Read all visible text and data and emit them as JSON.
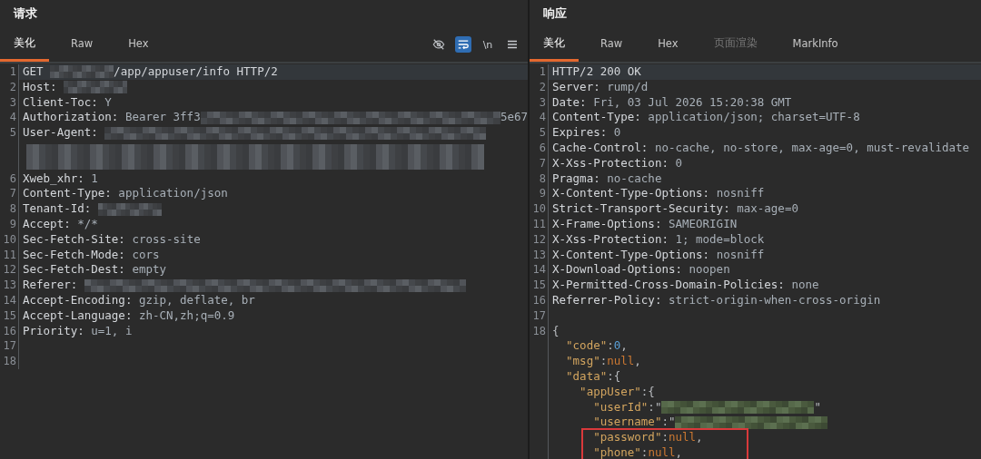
{
  "request": {
    "title": "请求",
    "tabs": [
      {
        "label": "美化",
        "selected": true
      },
      {
        "label": "Raw",
        "selected": false
      },
      {
        "label": "Hex",
        "selected": false
      }
    ],
    "toolbar": [
      {
        "kind": "hide",
        "on": false
      },
      {
        "kind": "wrap",
        "on": true
      },
      {
        "kind": "newline",
        "text": "\\n",
        "on": false
      },
      {
        "kind": "menu"
      }
    ],
    "lines": [
      {
        "num": "1",
        "current": true,
        "parts": [
          {
            "kind": "name",
            "text": "GET "
          },
          {
            "kind": "blur"
          },
          {
            "kind": "name",
            "text": "/app/appuser/info HTTP/2"
          }
        ]
      },
      {
        "num": "2",
        "current": false,
        "parts": [
          {
            "kind": "name",
            "text": "Host: "
          },
          {
            "kind": "blur"
          }
        ]
      },
      {
        "num": "3",
        "current": false,
        "parts": [
          {
            "kind": "name",
            "text": "Client-Toc: "
          },
          {
            "kind": "value",
            "text": "Y"
          }
        ]
      },
      {
        "num": "4",
        "current": false,
        "parts": [
          {
            "kind": "name",
            "text": "Authorization: "
          },
          {
            "kind": "value",
            "text": "Bearer 3ff3"
          },
          {
            "kind": "blur-long"
          },
          {
            "kind": "value",
            "text": "5e67"
          }
        ]
      },
      {
        "num": "5",
        "current": false,
        "parts": [
          {
            "kind": "name",
            "text": "User-Agent: "
          },
          {
            "kind": "blur-long"
          },
          {
            "kind": "blur-wrap"
          }
        ]
      },
      {
        "num": "6",
        "current": false,
        "parts": [
          {
            "kind": "name",
            "text": "Xweb_xhr: "
          },
          {
            "kind": "value",
            "text": "1"
          }
        ]
      },
      {
        "num": "7",
        "current": false,
        "parts": [
          {
            "kind": "name",
            "text": "Content-Type: "
          },
          {
            "kind": "value",
            "text": "application/json"
          }
        ]
      },
      {
        "num": "8",
        "current": false,
        "parts": [
          {
            "kind": "name",
            "text": "Tenant-Id: "
          },
          {
            "kind": "blur"
          }
        ]
      },
      {
        "num": "9",
        "current": false,
        "parts": [
          {
            "kind": "name",
            "text": "Accept: "
          },
          {
            "kind": "value",
            "text": "*/*"
          }
        ]
      },
      {
        "num": "10",
        "current": false,
        "parts": [
          {
            "kind": "name",
            "text": "Sec-Fetch-Site: "
          },
          {
            "kind": "value",
            "text": "cross-site"
          }
        ]
      },
      {
        "num": "11",
        "current": false,
        "parts": [
          {
            "kind": "name",
            "text": "Sec-Fetch-Mode: "
          },
          {
            "kind": "value",
            "text": "cors"
          }
        ]
      },
      {
        "num": "12",
        "current": false,
        "parts": [
          {
            "kind": "name",
            "text": "Sec-Fetch-Dest: "
          },
          {
            "kind": "value",
            "text": "empty"
          }
        ]
      },
      {
        "num": "13",
        "current": false,
        "parts": [
          {
            "kind": "name",
            "text": "Referer: "
          },
          {
            "kind": "blur-long"
          }
        ]
      },
      {
        "num": "14",
        "current": false,
        "parts": [
          {
            "kind": "name",
            "text": "Accept-Encoding: "
          },
          {
            "kind": "value",
            "text": "gzip, deflate, br"
          }
        ]
      },
      {
        "num": "15",
        "current": false,
        "parts": [
          {
            "kind": "name",
            "text": "Accept-Language: "
          },
          {
            "kind": "value",
            "text": "zh-CN,zh;q=0.9"
          }
        ]
      },
      {
        "num": "16",
        "current": false,
        "parts": [
          {
            "kind": "name",
            "text": "Priority: "
          },
          {
            "kind": "value",
            "text": "u=1, i"
          }
        ]
      },
      {
        "num": "17",
        "current": false
      },
      {
        "num": "18",
        "current": false
      }
    ]
  },
  "response": {
    "title": "响应",
    "tabs": [
      {
        "label": "美化",
        "selected": true,
        "disabled": false
      },
      {
        "label": "Raw",
        "selected": false,
        "disabled": false
      },
      {
        "label": "Hex",
        "selected": false,
        "disabled": false
      },
      {
        "label": "页面渲染",
        "selected": false,
        "disabled": true
      },
      {
        "label": "MarkInfo",
        "selected": false,
        "disabled": false
      }
    ],
    "lines": [
      {
        "num": "1",
        "current": true,
        "parts": [
          {
            "kind": "name",
            "text": "HTTP/2 200 OK"
          }
        ]
      },
      {
        "num": "2",
        "current": false,
        "parts": [
          {
            "kind": "name",
            "text": "Server: "
          },
          {
            "kind": "value",
            "text": "rump/d"
          }
        ]
      },
      {
        "num": "3",
        "current": false,
        "parts": [
          {
            "kind": "name",
            "text": "Date: "
          },
          {
            "kind": "value",
            "text": "Fri, 03 Jul 2026 15:20:38 GMT"
          }
        ]
      },
      {
        "num": "4",
        "current": false,
        "parts": [
          {
            "kind": "name",
            "text": "Content-Type: "
          },
          {
            "kind": "value",
            "text": "application/json; charset=UTF-8"
          }
        ]
      },
      {
        "num": "5",
        "current": false,
        "parts": [
          {
            "kind": "name",
            "text": "Expires: "
          },
          {
            "kind": "value",
            "text": "0"
          }
        ]
      },
      {
        "num": "6",
        "current": false,
        "parts": [
          {
            "kind": "name",
            "text": "Cache-Control: "
          },
          {
            "kind": "value",
            "text": "no-cache, no-store, max-age=0, must-revalidate"
          }
        ]
      },
      {
        "num": "7",
        "current": false,
        "parts": [
          {
            "kind": "name",
            "text": "X-Xss-Protection: "
          },
          {
            "kind": "value",
            "text": "0"
          }
        ]
      },
      {
        "num": "8",
        "current": false,
        "parts": [
          {
            "kind": "name",
            "text": "Pragma: "
          },
          {
            "kind": "value",
            "text": "no-cache"
          }
        ]
      },
      {
        "num": "9",
        "current": false,
        "parts": [
          {
            "kind": "name",
            "text": "X-Content-Type-Options: "
          },
          {
            "kind": "value",
            "text": "nosniff"
          }
        ]
      },
      {
        "num": "10",
        "current": false,
        "parts": [
          {
            "kind": "name",
            "text": "Strict-Transport-Security: "
          },
          {
            "kind": "value",
            "text": "max-age=0"
          }
        ]
      },
      {
        "num": "11",
        "current": false,
        "parts": [
          {
            "kind": "name",
            "text": "X-Frame-Options: "
          },
          {
            "kind": "value",
            "text": "SAMEORIGIN"
          }
        ]
      },
      {
        "num": "12",
        "current": false,
        "parts": [
          {
            "kind": "name",
            "text": "X-Xss-Protection: "
          },
          {
            "kind": "value",
            "text": "1; mode=block"
          }
        ]
      },
      {
        "num": "13",
        "current": false,
        "parts": [
          {
            "kind": "name",
            "text": "X-Content-Type-Options: "
          },
          {
            "kind": "value",
            "text": "nosniff"
          }
        ]
      },
      {
        "num": "14",
        "current": false,
        "parts": [
          {
            "kind": "name",
            "text": "X-Download-Options: "
          },
          {
            "kind": "value",
            "text": "noopen"
          }
        ]
      },
      {
        "num": "15",
        "current": false,
        "parts": [
          {
            "kind": "name",
            "text": "X-Permitted-Cross-Domain-Policies: "
          },
          {
            "kind": "value",
            "text": "none"
          }
        ]
      },
      {
        "num": "16",
        "current": false,
        "parts": [
          {
            "kind": "name",
            "text": "Referrer-Policy: "
          },
          {
            "kind": "value",
            "text": "strict-origin-when-cross-origin"
          }
        ]
      },
      {
        "num": "17",
        "current": false
      },
      {
        "num": "18",
        "current": false,
        "parts": [
          {
            "kind": "punct",
            "text": "{"
          }
        ]
      },
      {
        "current": false,
        "parts": [
          {
            "kind": "key",
            "text": "  \"code\""
          },
          {
            "kind": "punct",
            "text": ":"
          },
          {
            "kind": "num",
            "text": "0"
          },
          {
            "kind": "punct",
            "text": ","
          }
        ]
      },
      {
        "current": false,
        "parts": [
          {
            "kind": "key",
            "text": "  \"msg\""
          },
          {
            "kind": "punct",
            "text": ":"
          },
          {
            "kind": "null",
            "text": "null"
          },
          {
            "kind": "punct",
            "text": ","
          }
        ]
      },
      {
        "current": false,
        "parts": [
          {
            "kind": "key",
            "text": "  \"data\""
          },
          {
            "kind": "punct",
            "text": ":{"
          }
        ]
      },
      {
        "current": false,
        "parts": [
          {
            "kind": "key",
            "text": "    \"appUser\""
          },
          {
            "kind": "punct",
            "text": ":{"
          }
        ]
      },
      {
        "current": false,
        "parts": [
          {
            "kind": "key",
            "text": "      \"userId\""
          },
          {
            "kind": "punct",
            "text": ":\""
          },
          {
            "kind": "blur-green"
          },
          {
            "kind": "punct",
            "text": "\""
          }
        ]
      },
      {
        "current": false,
        "parts": [
          {
            "kind": "key",
            "text": "      \"username\""
          },
          {
            "kind": "punct",
            "text": ":\""
          },
          {
            "kind": "blur-green"
          }
        ]
      },
      {
        "current": false,
        "boxed": true,
        "parts": [
          {
            "kind": "key",
            "text": "      \"password\""
          },
          {
            "kind": "punct",
            "text": ":"
          },
          {
            "kind": "null",
            "text": "null"
          },
          {
            "kind": "punct",
            "text": ","
          }
        ]
      },
      {
        "current": false,
        "boxed": true,
        "parts": [
          {
            "kind": "key",
            "text": "      \"phone\""
          },
          {
            "kind": "punct",
            "text": ":"
          },
          {
            "kind": "null",
            "text": "null"
          },
          {
            "kind": "punct",
            "text": ","
          }
        ]
      }
    ]
  }
}
